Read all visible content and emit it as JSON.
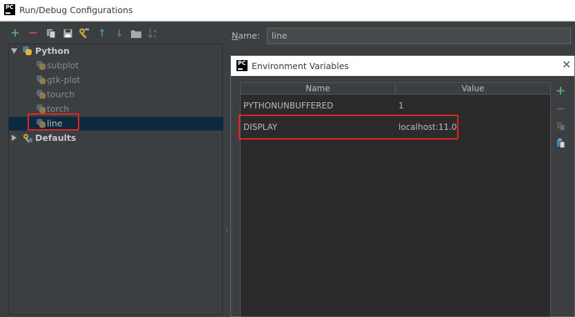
{
  "window": {
    "title": "Run/Debug Configurations",
    "logo": "PC"
  },
  "toolbar": {
    "icons": [
      "add-icon",
      "remove-icon",
      "copy-icon",
      "save-icon",
      "wrench-icon",
      "move-up-icon",
      "move-down-icon",
      "folder-icon",
      "sort-icon"
    ],
    "add_glyph": "+",
    "remove_glyph": "−",
    "up_glyph": "↑",
    "down_glyph": "↓",
    "colors": {
      "add": "#59a869",
      "remove": "#c75450",
      "up": "#3592c4",
      "disabled": "#6e6e6e"
    }
  },
  "tree": {
    "python_label": "Python",
    "items": [
      {
        "label": "subplot"
      },
      {
        "label": "gtk-plot"
      },
      {
        "label": "tourch"
      },
      {
        "label": "torch"
      },
      {
        "label": "line",
        "selected": true
      }
    ],
    "defaults_label": "Defaults"
  },
  "name_field": {
    "label_prefix": "N",
    "label_rest": "ame:",
    "value": "line"
  },
  "env_dialog": {
    "logo": "PC",
    "title": "Environment Variables",
    "close_glyph": "✕",
    "columns": [
      "Name",
      "Value"
    ],
    "rows": [
      {
        "name": "PYTHONUNBUFFERED",
        "value": "1"
      },
      {
        "name": "DISPLAY",
        "value": "localhost:11.0",
        "highlighted": true
      }
    ],
    "side_buttons": [
      "add-icon",
      "remove-icon",
      "copy-icon",
      "paste-icon"
    ]
  },
  "colors": {
    "selection": "#0d293e",
    "highlight": "#e8251e",
    "panel": "#3c3f41",
    "table": "#2b2b2b"
  }
}
